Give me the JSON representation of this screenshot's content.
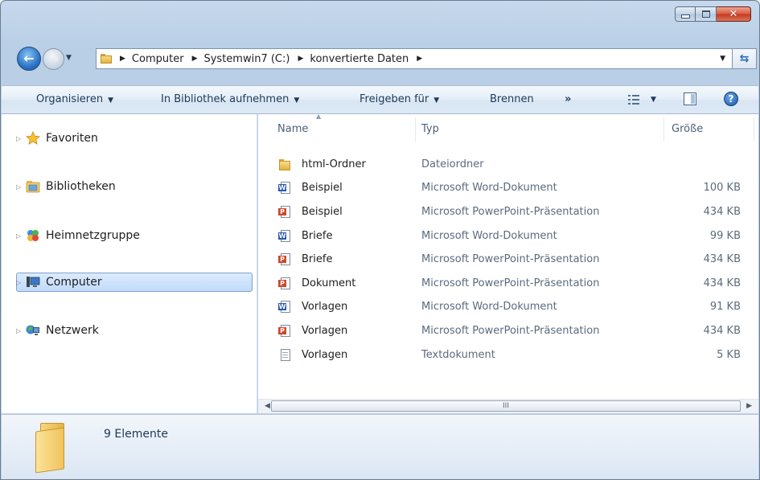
{
  "address": {
    "crumbs": [
      "Computer",
      "Systemwin7 (C:)",
      "konvertierte Daten"
    ]
  },
  "toolbar": {
    "organize": "Organisieren",
    "include_library": "In Bibliothek aufnehmen",
    "share": "Freigeben für",
    "burn": "Brennen",
    "more": "»",
    "help": "?"
  },
  "nav": {
    "items": [
      {
        "label": "Favoriten",
        "icon": "star-icon"
      },
      {
        "label": "Bibliotheken",
        "icon": "library-icon"
      },
      {
        "label": "Heimnetzgruppe",
        "icon": "homegroup-icon"
      },
      {
        "label": "Computer",
        "icon": "computer-icon",
        "selected": true
      },
      {
        "label": "Netzwerk",
        "icon": "network-icon"
      }
    ]
  },
  "columns": {
    "name": "Name",
    "type": "Typ",
    "size": "Größe"
  },
  "files": [
    {
      "name": "html-Ordner",
      "type": "Dateiordner",
      "size": "",
      "icon": "folder-icon"
    },
    {
      "name": "Beispiel",
      "type": "Microsoft Word-Dokument",
      "size": "100 KB",
      "icon": "word-document-icon"
    },
    {
      "name": "Beispiel",
      "type": "Microsoft PowerPoint-Präsentation",
      "size": "434 KB",
      "icon": "powerpoint-icon"
    },
    {
      "name": "Briefe",
      "type": "Microsoft Word-Dokument",
      "size": "99 KB",
      "icon": "word-document-icon"
    },
    {
      "name": "Briefe",
      "type": "Microsoft PowerPoint-Präsentation",
      "size": "434 KB",
      "icon": "powerpoint-icon"
    },
    {
      "name": "Dokument",
      "type": "Microsoft PowerPoint-Präsentation",
      "size": "434 KB",
      "icon": "powerpoint-icon"
    },
    {
      "name": "Vorlagen",
      "type": "Microsoft Word-Dokument",
      "size": "91 KB",
      "icon": "word-document-icon"
    },
    {
      "name": "Vorlagen",
      "type": "Microsoft PowerPoint-Präsentation",
      "size": "434 KB",
      "icon": "powerpoint-icon"
    },
    {
      "name": "Vorlagen",
      "type": "Textdokument",
      "size": "5 KB",
      "icon": "text-document-icon"
    }
  ],
  "scrollbar": {
    "thumb_grip": "III"
  },
  "status": {
    "count": "9 Elemente"
  }
}
